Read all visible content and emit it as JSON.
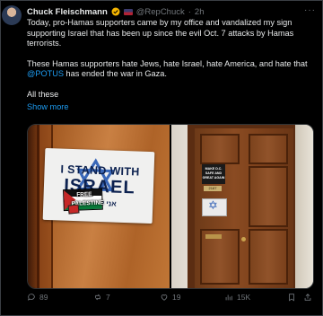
{
  "post": {
    "author_name": "Chuck Fleischmann",
    "handle": "@RepChuck",
    "separator": "·",
    "time": "2h",
    "more_label": "···",
    "text_p1": "Today, pro-Hamas supporters came by my office and vandalized my sign supporting Israel that has been up since the evil Oct. 7 attacks by Hamas terrorists.",
    "text_p2_a": "These Hamas supporters hate Jews, hate Israel, hate America, and hate that ",
    "text_p2_mention": "@POTUS",
    "text_p2_b": " has ended the war in Gaza.",
    "text_p3": "All these",
    "show_more": "Show more"
  },
  "media": {
    "sign": {
      "line1": "I STAND WITH",
      "line2": "ISRAEL",
      "hebrew": "אני עומד",
      "sticker_line1": "FREE",
      "sticker_line2": "PALESTINE"
    },
    "door_placard": "MAKE D.C. SAFE AND GREAT AGAIN",
    "door_number": "2187"
  },
  "actions": {
    "replies": "89",
    "reposts": "7",
    "likes": "19",
    "views": "15K"
  },
  "colors": {
    "background": "#000000",
    "text": "#e7e9ea",
    "muted": "#71767b",
    "link": "#1d9bf0",
    "verified": "#f4b400"
  },
  "icons": [
    "avatar",
    "verified-badge-icon",
    "flag-icon",
    "more-icon",
    "reply-icon",
    "repost-icon",
    "like-icon",
    "views-icon",
    "bookmark-icon",
    "share-icon"
  ]
}
